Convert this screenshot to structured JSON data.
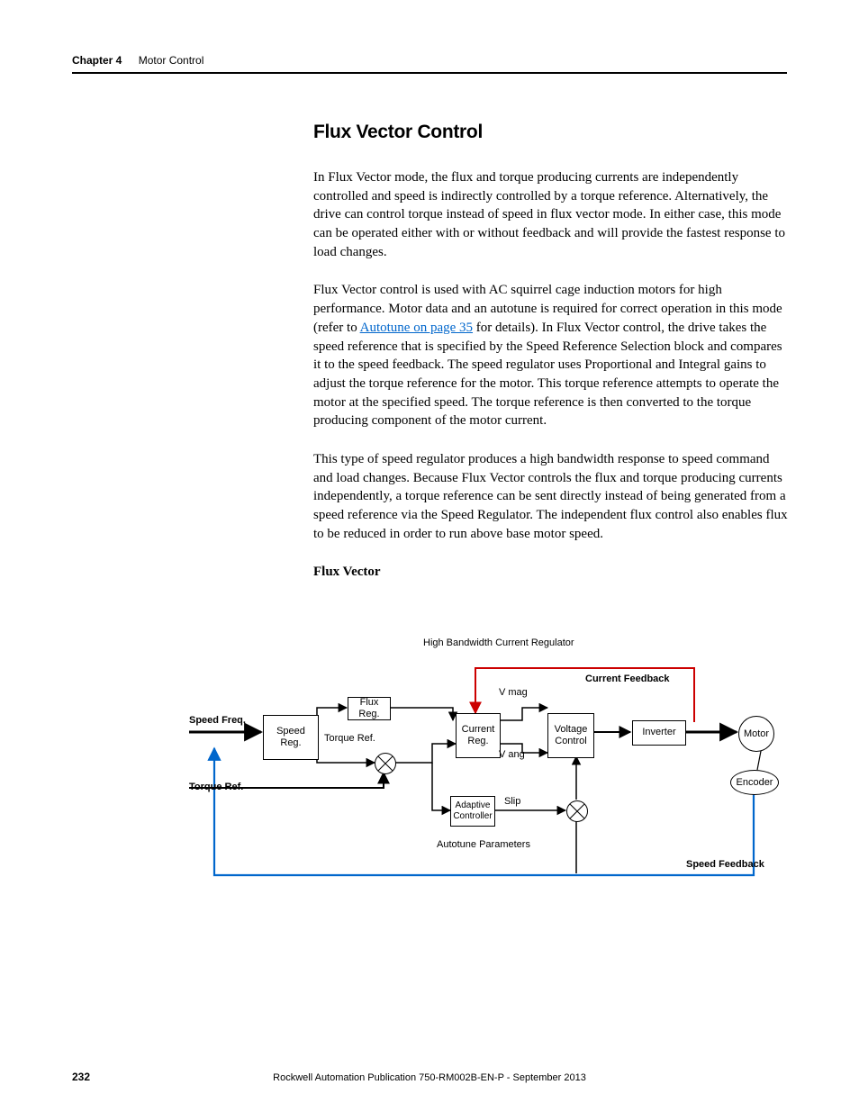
{
  "header": {
    "chapter": "Chapter 4",
    "title": "Motor Control"
  },
  "section": {
    "heading": "Flux Vector Control",
    "p1": "In Flux Vector mode, the flux and torque producing currents are independently controlled and speed is indirectly controlled by a torque reference. Alternatively, the drive can control torque instead of speed in flux vector mode. In either case, this mode can be operated either with or without feedback and will provide the fastest response to load changes.",
    "p2_a": "Flux Vector control is used with AC squirrel cage induction motors for high performance. Motor data and an autotune is required for correct operation in this mode (refer to ",
    "p2_link": "Autotune on page 35",
    "p2_b": " for details). In Flux Vector control, the drive takes the speed reference that is specified by the Speed Reference Selection block and compares it to the speed feedback. The speed regulator uses Proportional and Integral gains to adjust the torque reference for the motor. This torque reference attempts to operate the motor at the specified speed. The torque reference is then converted to the torque producing component of the motor current.",
    "p3": "This type of speed regulator produces a high bandwidth response to speed command and load changes. Because Flux Vector controls the flux and torque producing currents independently, a torque reference can be sent directly instead of being generated from a speed reference via the Speed Regulator. The independent flux control also enables flux to be reduced in order to run above base motor speed.",
    "fig_title": "Flux Vector"
  },
  "diagram": {
    "caption_top": "High Bandwidth Current Regulator",
    "speed_freq": "Speed Freq.",
    "torque_ref_in": "Torque Ref.",
    "speed_reg": "Speed\nReg.",
    "flux_reg": "Flux Reg.",
    "torque_ref_mid": "Torque Ref.",
    "current_reg": "Current\nReg.",
    "vmag": "V mag",
    "vang": "V ang",
    "voltage_control": "Voltage\nControl",
    "inverter": "Inverter",
    "motor": "Motor",
    "encoder": "Encoder",
    "current_feedback": "Current Feedback",
    "adaptive_controller": "Adaptive\nController",
    "slip": "Slip",
    "autotune_params": "Autotune Parameters",
    "speed_feedback": "Speed Feedback"
  },
  "footer": {
    "page": "232",
    "pub": "Rockwell Automation Publication 750-RM002B-EN-P - September 2013"
  }
}
